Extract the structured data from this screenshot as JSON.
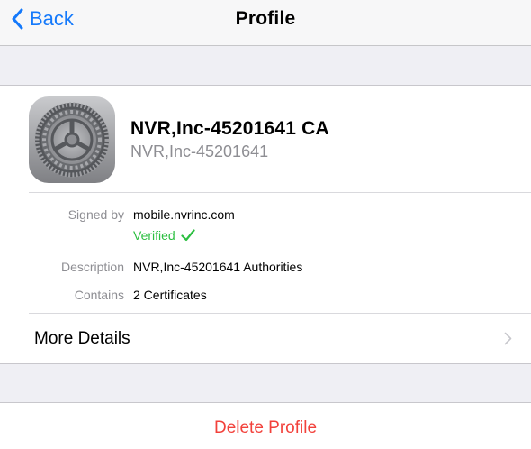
{
  "nav": {
    "back_label": "Back",
    "title": "Profile"
  },
  "profile": {
    "icon": "settings-gear-icon",
    "name": "NVR,Inc-45201641 CA",
    "subtitle": "NVR,Inc-45201641"
  },
  "details": {
    "signed_by_label": "Signed by",
    "signed_by_value": "mobile.nvrinc.com",
    "verified_label": "Verified",
    "description_label": "Description",
    "description_value": "NVR,Inc-45201641 Authorities",
    "contains_label": "Contains",
    "contains_value": "2 Certificates"
  },
  "more_details": {
    "label": "More Details"
  },
  "actions": {
    "delete_label": "Delete Profile"
  },
  "colors": {
    "accent_blue": "#1479fb",
    "verified_green": "#2cbf41",
    "destructive_red": "#f2413b",
    "group_background": "#efeff4"
  }
}
